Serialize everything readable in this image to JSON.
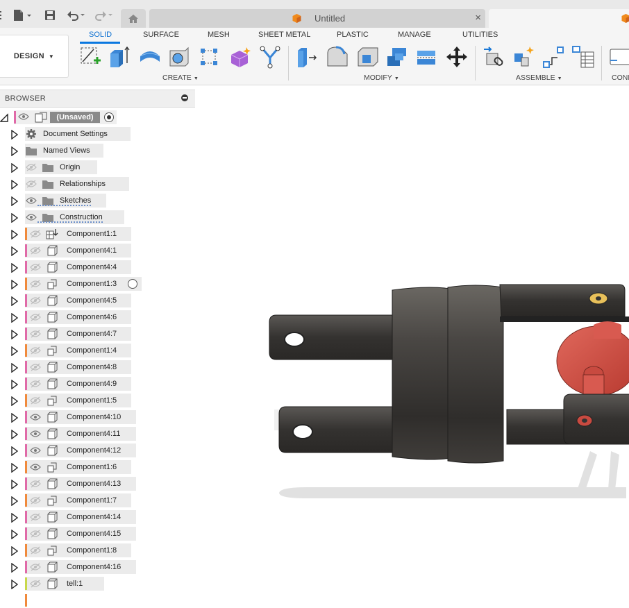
{
  "tabs": {
    "home_tooltip": "",
    "document_title": "Untitled",
    "close_glyph": "×"
  },
  "toolbar": {
    "workspace_label": "DESIGN",
    "workspace_tabs": [
      "SOLID",
      "SURFACE",
      "MESH",
      "SHEET METAL",
      "PLASTIC",
      "MANAGE",
      "UTILITIES"
    ],
    "active_tab": "SOLID",
    "groups": {
      "create": "CREATE",
      "modify": "MODIFY",
      "assemble": "ASSEMBLE",
      "configure": "CONF"
    },
    "accent_color": "#0a78e0"
  },
  "browser": {
    "title": "BROWSER",
    "root_label": "(Unsaved)",
    "items": [
      {
        "label": "Document Settings",
        "icon": "gear-icon",
        "eye": "none",
        "color": ""
      },
      {
        "label": "Named Views",
        "icon": "folder-icon",
        "eye": "none",
        "color": ""
      },
      {
        "label": "Origin",
        "icon": "folder-icon",
        "eye": "hidden",
        "color": ""
      },
      {
        "label": "Relationships",
        "icon": "folder-icon",
        "eye": "hidden",
        "color": ""
      },
      {
        "label": "Sketches",
        "icon": "folder-icon",
        "eye": "visible",
        "color": ""
      },
      {
        "label": "Construction",
        "icon": "folder-icon",
        "eye": "visible",
        "color": ""
      },
      {
        "label": "Component1:1",
        "icon": "component-link-icon",
        "eye": "hidden",
        "color": "#f08a3c"
      },
      {
        "label": "Component4:1",
        "icon": "component-icon",
        "eye": "hidden",
        "color": "#e06aa8"
      },
      {
        "label": "Component4:4",
        "icon": "component-icon",
        "eye": "hidden",
        "color": "#e06aa8"
      },
      {
        "label": "Component1:3",
        "icon": "component-multi-icon",
        "eye": "hidden",
        "color": "#f08a3c"
      },
      {
        "label": "Component4:5",
        "icon": "component-icon",
        "eye": "hidden",
        "color": "#e06aa8"
      },
      {
        "label": "Component4:6",
        "icon": "component-icon",
        "eye": "hidden",
        "color": "#e06aa8"
      },
      {
        "label": "Component4:7",
        "icon": "component-icon",
        "eye": "hidden",
        "color": "#e06aa8"
      },
      {
        "label": "Component1:4",
        "icon": "component-multi-icon",
        "eye": "hidden",
        "color": "#f08a3c"
      },
      {
        "label": "Component4:8",
        "icon": "component-icon",
        "eye": "hidden",
        "color": "#e06aa8"
      },
      {
        "label": "Component4:9",
        "icon": "component-icon",
        "eye": "hidden",
        "color": "#e06aa8"
      },
      {
        "label": "Component1:5",
        "icon": "component-multi-icon",
        "eye": "hidden",
        "color": "#f08a3c"
      },
      {
        "label": "Component4:10",
        "icon": "component-icon",
        "eye": "visible",
        "color": "#e06aa8"
      },
      {
        "label": "Component4:11",
        "icon": "component-icon",
        "eye": "visible",
        "color": "#e06aa8"
      },
      {
        "label": "Component4:12",
        "icon": "component-icon",
        "eye": "visible",
        "color": "#e06aa8"
      },
      {
        "label": "Component1:6",
        "icon": "component-multi-icon",
        "eye": "visible",
        "color": "#f08a3c"
      },
      {
        "label": "Component4:13",
        "icon": "component-icon",
        "eye": "hidden",
        "color": "#e06aa8"
      },
      {
        "label": "Component1:7",
        "icon": "component-multi-icon",
        "eye": "hidden",
        "color": "#f08a3c"
      },
      {
        "label": "Component4:14",
        "icon": "component-icon",
        "eye": "hidden",
        "color": "#e06aa8"
      },
      {
        "label": "Component4:15",
        "icon": "component-icon",
        "eye": "hidden",
        "color": "#e06aa8"
      },
      {
        "label": "Component1:8",
        "icon": "component-multi-icon",
        "eye": "hidden",
        "color": "#f08a3c"
      },
      {
        "label": "Component4:16",
        "icon": "component-icon",
        "eye": "hidden",
        "color": "#e06aa8"
      },
      {
        "label": "tell:1",
        "icon": "component-icon",
        "eye": "hidden",
        "color": "#c8d84a"
      }
    ]
  }
}
